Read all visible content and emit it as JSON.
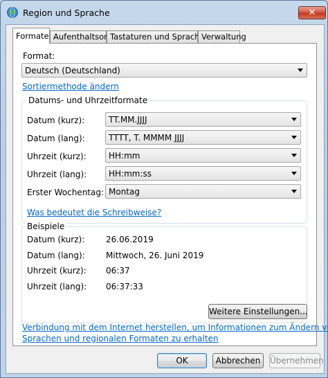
{
  "window": {
    "title": "Region und Sprache",
    "close_glyph": "✕"
  },
  "tabs": [
    {
      "label": "Formate",
      "active": true
    },
    {
      "label": "Aufenthaltsort",
      "active": false
    },
    {
      "label": "Tastaturen und Sprachen",
      "active": false
    },
    {
      "label": "Verwaltung",
      "active": false
    }
  ],
  "format": {
    "label": "Format:",
    "value": "Deutsch (Deutschland)",
    "sort_link": "Sortiermethode ändern"
  },
  "datetime_formats": {
    "title": "Datums- und Uhrzeitformate",
    "rows": [
      {
        "label": "Datum (kurz):",
        "value": "TT.MM.JJJJ"
      },
      {
        "label": "Datum (lang):",
        "value": "TTTT, T. MMMM JJJJ"
      },
      {
        "label": "Uhrzeit (kurz):",
        "value": "HH:mm"
      },
      {
        "label": "Uhrzeit (lang):",
        "value": "HH:mm:ss"
      },
      {
        "label": "Erster Wochentag:",
        "value": "Montag"
      }
    ],
    "notation_link": "Was bedeutet die Schreibweise?"
  },
  "examples": {
    "title": "Beispiele",
    "rows": [
      {
        "label": "Datum (kurz):",
        "value": "26.06.2019"
      },
      {
        "label": "Datum (lang):",
        "value": "Mittwoch, 26. Juni 2019"
      },
      {
        "label": "Uhrzeit (kurz):",
        "value": "06:37"
      },
      {
        "label": "Uhrzeit (lang):",
        "value": "06:37:33"
      }
    ]
  },
  "more_settings_button": "Weitere Einstellungen...",
  "internet_link": {
    "line1": "Verbindung mit dem Internet herstellen, um Informationen zum Ändern von",
    "line2": "Sprachen und regionalen Formaten zu erhalten"
  },
  "buttons": {
    "ok": "OK",
    "cancel": "Abbrechen",
    "apply": "Übernehmen"
  },
  "icons": {
    "title": "globe-icon",
    "close": "close-icon",
    "dropdown": "chevron-down-icon"
  }
}
